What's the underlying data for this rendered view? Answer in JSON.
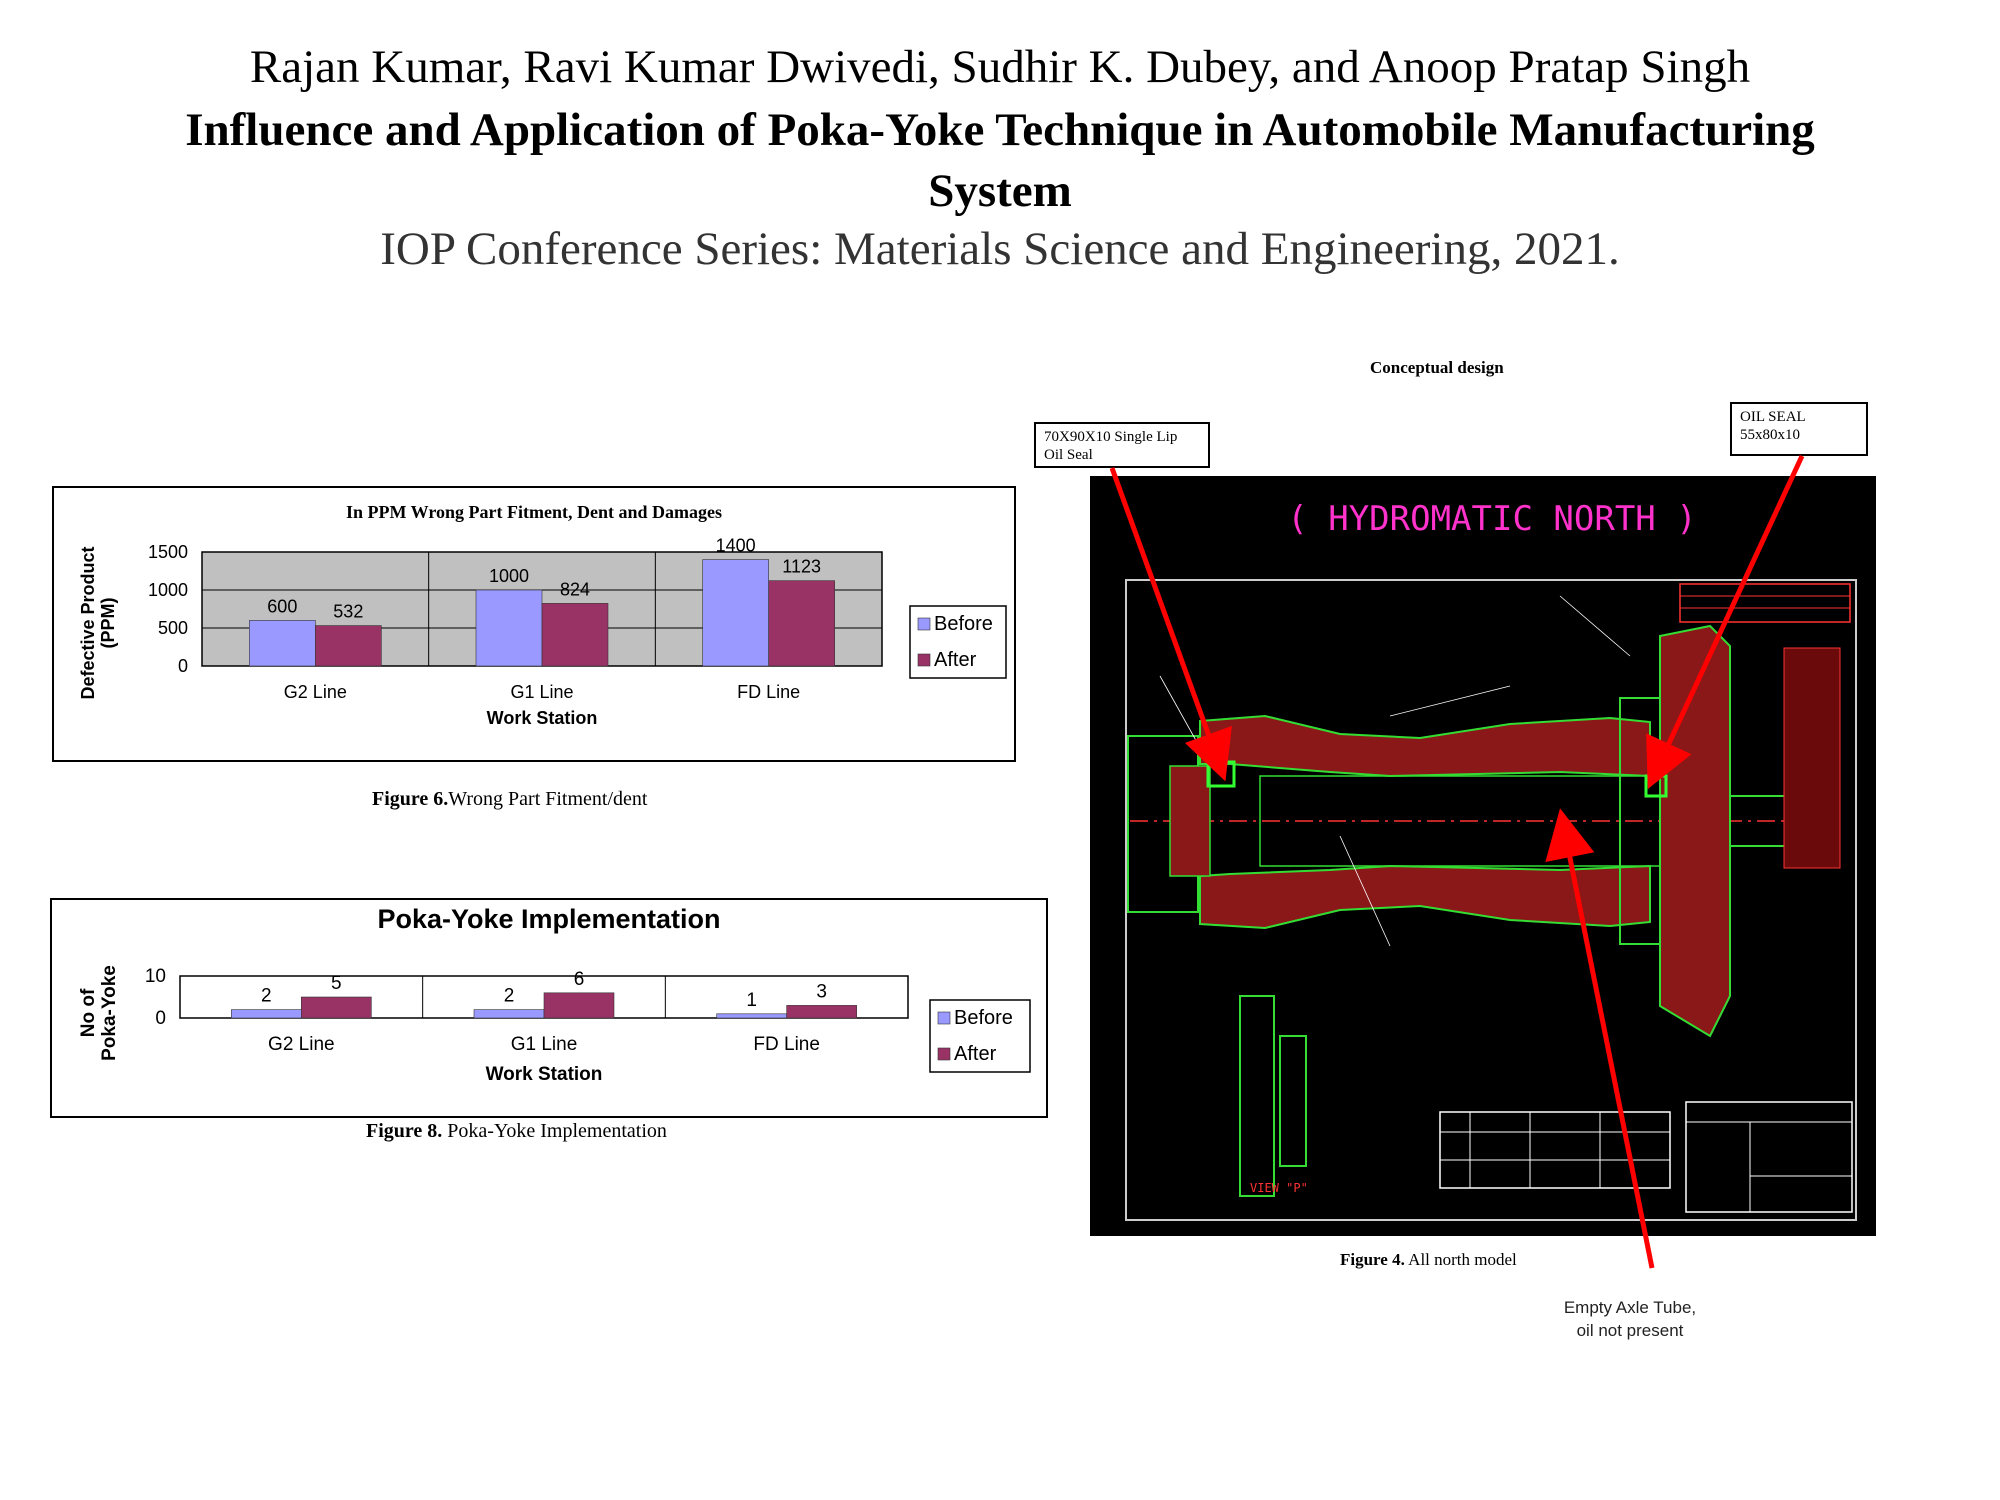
{
  "header": {
    "authors": "Rajan Kumar, Ravi Kumar Dwivedi, Sudhir K. Dubey, and Anoop Pratap Singh",
    "title_line1": "Influence and Application of Poka-Yoke Technique in Automobile Manufacturing",
    "title_line2": "System",
    "venue": "IOP Conference Series: Materials Science and Engineering, 2021."
  },
  "chart_data": [
    {
      "type": "bar",
      "title": "In PPM Wrong Part Fitment, Dent and Damages",
      "xlabel": "Work Station",
      "ylabel": "Defective Product (PPM)",
      "ylim": [
        0,
        1500
      ],
      "yticks": [
        "0",
        "500",
        "1000",
        "1500"
      ],
      "grid": true,
      "legend": "right",
      "categories": [
        "G2 Line",
        "G1 Line",
        "FD Line"
      ],
      "series": [
        {
          "name": "Before",
          "values": [
            600,
            1000,
            1400
          ],
          "color": "#9999ff"
        },
        {
          "name": "After",
          "values": [
            532,
            824,
            1123
          ],
          "color": "#993366"
        }
      ]
    },
    {
      "type": "bar",
      "title": "Poka-Yoke Implementation",
      "xlabel": "Work Station",
      "ylabel": "No of Poka-Yoke",
      "ylim": [
        0,
        10
      ],
      "yticks": [
        "0",
        "10"
      ],
      "grid": false,
      "legend": "right",
      "categories": [
        "G2 Line",
        "G1 Line",
        "FD Line"
      ],
      "series": [
        {
          "name": "Before",
          "values": [
            2,
            2,
            1
          ],
          "color": "#9999ff"
        },
        {
          "name": "After",
          "values": [
            5,
            6,
            3
          ],
          "color": "#993366"
        }
      ]
    }
  ],
  "captions": {
    "fig6_label": "Figure 6.",
    "fig6_text": "Wrong Part Fitment/dent",
    "fig8_label": "Figure 8.",
    "fig8_text": " Poka-Yoke Implementation",
    "fig4_label": "Figure 4.",
    "fig4_text": " All north model"
  },
  "cad": {
    "heading": "Conceptual design",
    "drawing_title": "( HYDROMATIC NORTH )",
    "label_left": "70X90X10 Single Lip Oil Seal",
    "label_right_line1": "OIL SEAL",
    "label_right_line2": "55x80x10",
    "label_bottom_line1": "Empty Axle Tube,",
    "label_bottom_line2": "oil not present",
    "view_label": "VIEW \"P\"",
    "colors": {
      "outline": "#22cc22",
      "hatch": "#cc2222",
      "title": "#ff33cc",
      "arrow": "#ff0000"
    }
  }
}
